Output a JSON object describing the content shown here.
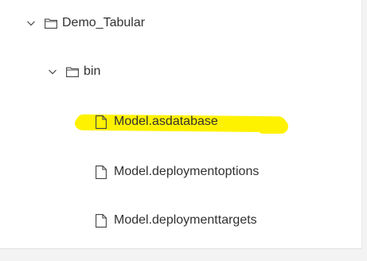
{
  "tree": {
    "items": [
      {
        "label": "Demo_Tabular",
        "type": "folder",
        "expanded": true,
        "level": 0
      },
      {
        "label": "bin",
        "type": "folder",
        "expanded": true,
        "level": 1
      },
      {
        "label": "Model.asdatabase",
        "type": "file",
        "level": 2,
        "highlighted": true
      },
      {
        "label": "Model.deploymentoptions",
        "type": "file",
        "level": 2
      },
      {
        "label": "Model.deploymenttargets",
        "type": "file",
        "level": 2
      }
    ]
  },
  "colors": {
    "highlight": "#fff200",
    "text": "#323130",
    "icon": "#444444",
    "background": "#ffffff"
  },
  "icons": {
    "expand": "chevron-down-icon",
    "folder": "folder-icon",
    "file": "file-icon"
  }
}
